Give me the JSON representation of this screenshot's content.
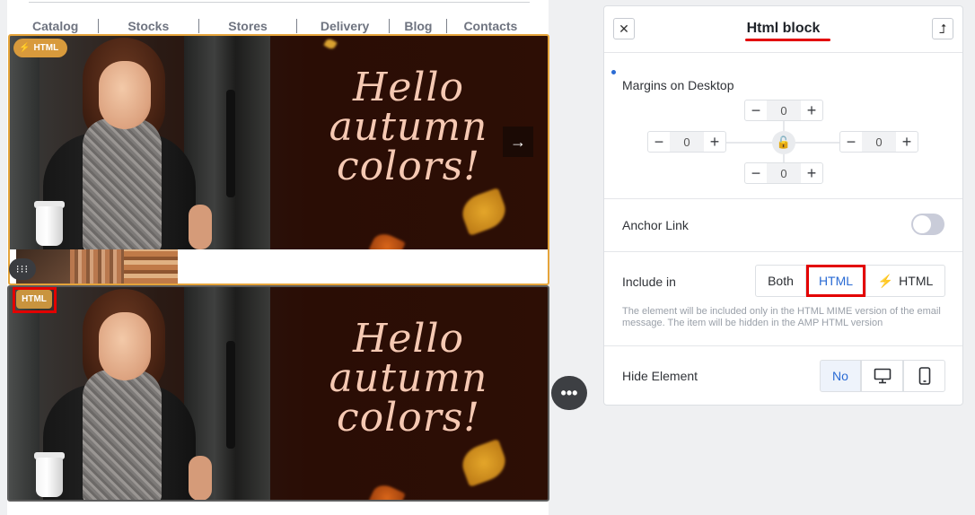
{
  "nav": {
    "items": [
      "Catalog",
      "Stocks",
      "Stores",
      "Delivery",
      "Blog",
      "Contacts"
    ]
  },
  "banner": {
    "headline": [
      "Hello",
      "autumn",
      "colors!"
    ],
    "next_icon": "arrow-right-icon",
    "headline_color": "#f6c9b3"
  },
  "badges": {
    "top_label": "HTML",
    "top_icon": "lightning-icon",
    "bottom_label": "HTML"
  },
  "canvas_controls": {
    "drag_icon": "dots-icon",
    "more_icon": "ellipsis-icon"
  },
  "panel": {
    "title": "Html block",
    "close_icon": "close-icon",
    "up_icon": "level-up-icon",
    "margins": {
      "label": "Margins on Desktop",
      "top": "0",
      "left": "0",
      "right": "0",
      "bottom": "0",
      "minus": "−",
      "plus": "+",
      "lock_icon": "unlock-icon"
    },
    "anchor": {
      "label": "Anchor Link",
      "enabled": false
    },
    "include": {
      "label": "Include in",
      "options": [
        "Both",
        "HTML",
        "HTML"
      ],
      "selected": "HTML",
      "amp_icon": "lightning-icon",
      "help": "The element will be included only in the HTML MIME version of the email message. The item will be hidden in the AMP HTML version"
    },
    "hide": {
      "label": "Hide Element",
      "no_label": "No",
      "desktop_icon": "desktop-icon",
      "mobile_icon": "mobile-icon"
    },
    "accent_color": "#2a6bd4",
    "highlight_color": "#e30000"
  }
}
